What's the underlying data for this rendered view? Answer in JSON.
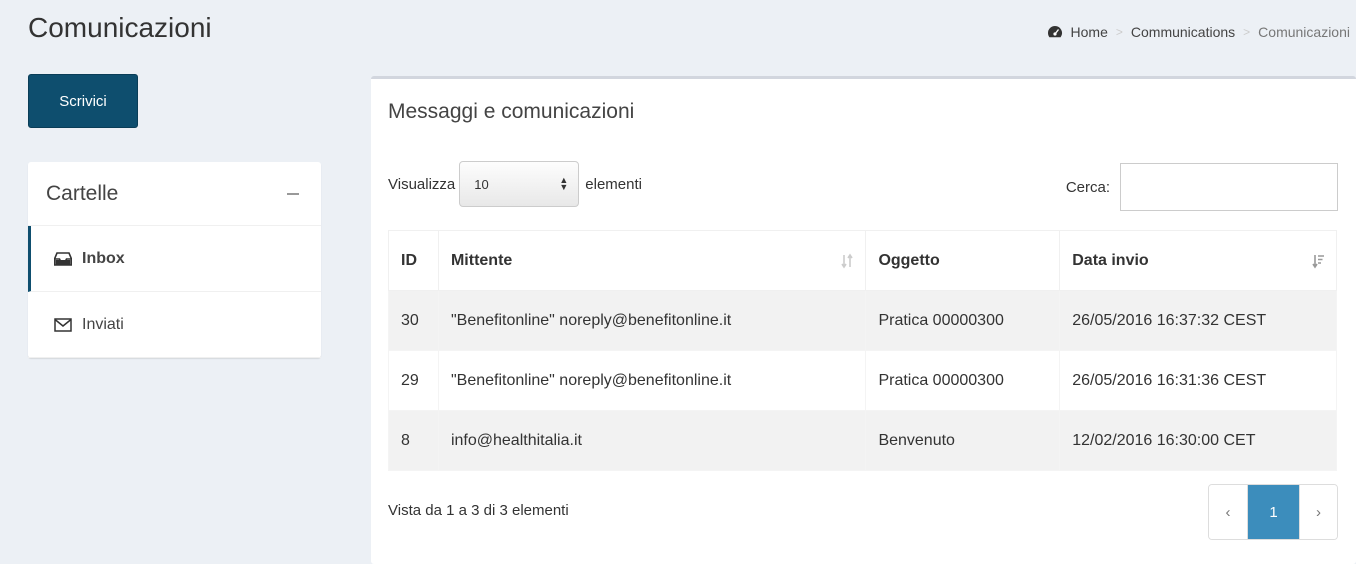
{
  "header": {
    "title": "Comunicazioni",
    "breadcrumb": [
      "Home",
      "Communications",
      "Comunicazioni"
    ]
  },
  "compose_button": "Scrivici",
  "folders": {
    "title": "Cartelle",
    "items": [
      {
        "label": "Inbox",
        "icon": "inbox-icon",
        "active": true
      },
      {
        "label": "Inviati",
        "icon": "envelope-icon",
        "active": false
      }
    ]
  },
  "messages": {
    "title": "Messaggi e comunicazioni",
    "length": {
      "prefix": "Visualizza",
      "value": "10",
      "suffix": "elementi"
    },
    "search": {
      "label": "Cerca:",
      "value": ""
    },
    "columns": [
      "ID",
      "Mittente",
      "Oggetto",
      "Data invio"
    ],
    "rows": [
      {
        "id": "30",
        "sender": "\"Benefitonline\" noreply@benefitonline.it",
        "subject": "Pratica 00000300",
        "date": "26/05/2016 16:37:32 CEST"
      },
      {
        "id": "29",
        "sender": "\"Benefitonline\" noreply@benefitonline.it",
        "subject": "Pratica 00000300",
        "date": "26/05/2016 16:31:36 CEST"
      },
      {
        "id": "8",
        "sender": "info@healthitalia.it",
        "subject": "Benvenuto",
        "date": "12/02/2016 16:30:00 CET"
      }
    ],
    "info": "Vista da 1 a 3 di 3 elementi",
    "pagination": {
      "prev": "‹",
      "current": "1",
      "next": "›"
    }
  },
  "colors": {
    "primary": "#0e4e6e",
    "page_active": "#3c8dbc",
    "background": "#ecf0f5"
  }
}
